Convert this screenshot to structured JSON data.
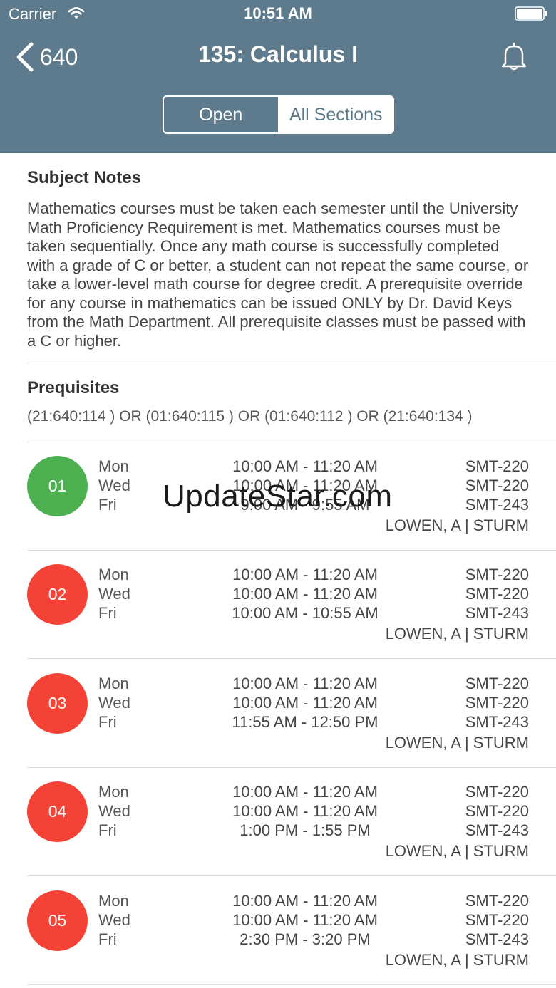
{
  "status_bar": {
    "carrier": "Carrier",
    "time": "10:51 AM"
  },
  "nav": {
    "back_label": "640",
    "title": "135: Calculus I"
  },
  "segmented": {
    "open_label": "Open",
    "all_label": "All Sections",
    "selected": "All Sections"
  },
  "notes": {
    "heading": "Subject Notes",
    "body": "Mathematics courses must be taken each semester until the University Math Proficiency Requirement is met. Mathematics courses must be taken sequentially. Once any math course is successfully completed with a grade of C or better, a student can not repeat the same course, or take a lower-level math course for degree credit. A prerequisite override for any course in mathematics can be issued ONLY by Dr. David Keys from the Math Department. All prerequisite classes must be passed with a C or higher."
  },
  "prereq": {
    "heading": "Prequisites",
    "body": "(21:640:114 ) OR (01:640:115 ) OR (01:640:112 ) OR (21:640:134 )"
  },
  "colors": {
    "header": "#5d7b8c",
    "open": "#4caf50",
    "closed": "#f44336"
  },
  "sections": [
    {
      "number": "01",
      "status": "open",
      "day1": "Mon",
      "day2": "Wed",
      "day3": "Fri",
      "time1": "10:00 AM - 11:20 AM",
      "time2": "10:00 AM - 11:20 AM",
      "time3": "9:00 AM - 9:55 AM",
      "room1": "SMT-220",
      "room2": "SMT-220",
      "room3": "SMT-243",
      "instructors": "LOWEN, A | STURM"
    },
    {
      "number": "02",
      "status": "closed",
      "day1": "Mon",
      "day2": "Wed",
      "day3": "Fri",
      "time1": "10:00 AM - 11:20 AM",
      "time2": "10:00 AM - 11:20 AM",
      "time3": "10:00 AM - 10:55 AM",
      "room1": "SMT-220",
      "room2": "SMT-220",
      "room3": "SMT-243",
      "instructors": "LOWEN, A | STURM"
    },
    {
      "number": "03",
      "status": "closed",
      "day1": "Mon",
      "day2": "Wed",
      "day3": "Fri",
      "time1": "10:00 AM - 11:20 AM",
      "time2": "10:00 AM - 11:20 AM",
      "time3": "11:55 AM - 12:50 PM",
      "room1": "SMT-220",
      "room2": "SMT-220",
      "room3": "SMT-243",
      "instructors": "LOWEN, A | STURM"
    },
    {
      "number": "04",
      "status": "closed",
      "day1": "Mon",
      "day2": "Wed",
      "day3": "Fri",
      "time1": "10:00 AM - 11:20 AM",
      "time2": "10:00 AM - 11:20 AM",
      "time3": "1:00 PM - 1:55 PM",
      "room1": "SMT-220",
      "room2": "SMT-220",
      "room3": "SMT-243",
      "instructors": "LOWEN, A | STURM"
    },
    {
      "number": "05",
      "status": "closed",
      "day1": "Mon",
      "day2": "Wed",
      "day3": "Fri",
      "time1": "10:00 AM - 11:20 AM",
      "time2": "10:00 AM - 11:20 AM",
      "time3": "2:30 PM - 3:20 PM",
      "room1": "SMT-220",
      "room2": "SMT-220",
      "room3": "SMT-243",
      "instructors": "LOWEN, A | STURM"
    }
  ],
  "watermark": "UpdateStar.com"
}
